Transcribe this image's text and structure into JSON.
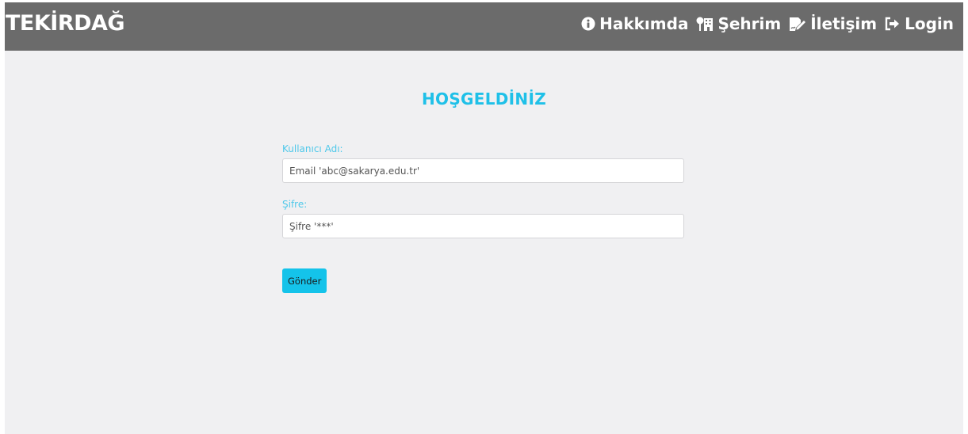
{
  "navbar": {
    "brand": "TEKİRDAĞ",
    "links": [
      {
        "label": "Hakkımda",
        "icon": "info-circle-icon"
      },
      {
        "label": "Şehrim",
        "icon": "city-icon"
      },
      {
        "label": "İletişim",
        "icon": "edit-icon"
      },
      {
        "label": "Login",
        "icon": "sign-in-icon"
      }
    ]
  },
  "main": {
    "title": "HOŞGELDİNİZ",
    "username": {
      "label": "Kullanıcı Adı:",
      "placeholder": "Email 'abc@sakarya.edu.tr'",
      "value": ""
    },
    "password": {
      "label": "Şifre:",
      "placeholder": "Şifre '***'",
      "value": ""
    },
    "submit_label": "Gönder"
  },
  "colors": {
    "navbar_bg": "#6b6b6b",
    "page_bg": "#f0f0f2",
    "accent": "#1fc0e8",
    "button_bg": "#14c3ea"
  }
}
